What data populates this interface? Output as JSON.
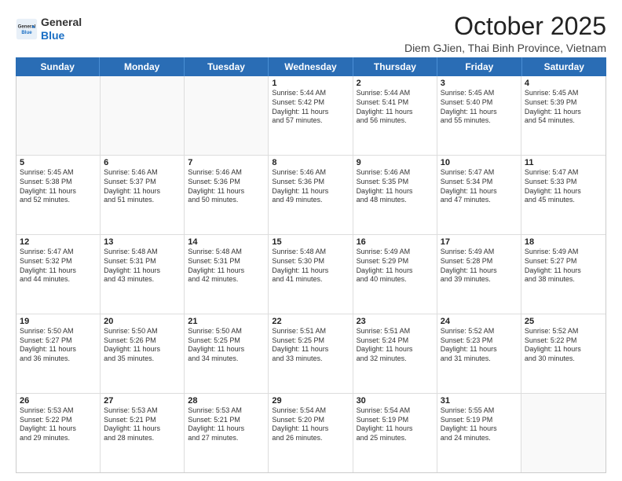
{
  "logo": {
    "general": "General",
    "blue": "Blue"
  },
  "title": "October 2025",
  "subtitle": "Diem GJien, Thai Binh Province, Vietnam",
  "header_days": [
    "Sunday",
    "Monday",
    "Tuesday",
    "Wednesday",
    "Thursday",
    "Friday",
    "Saturday"
  ],
  "rows": [
    [
      {
        "day": "",
        "lines": [],
        "empty": true
      },
      {
        "day": "",
        "lines": [],
        "empty": true
      },
      {
        "day": "",
        "lines": [],
        "empty": true
      },
      {
        "day": "1",
        "lines": [
          "Sunrise: 5:44 AM",
          "Sunset: 5:42 PM",
          "Daylight: 11 hours",
          "and 57 minutes."
        ]
      },
      {
        "day": "2",
        "lines": [
          "Sunrise: 5:44 AM",
          "Sunset: 5:41 PM",
          "Daylight: 11 hours",
          "and 56 minutes."
        ]
      },
      {
        "day": "3",
        "lines": [
          "Sunrise: 5:45 AM",
          "Sunset: 5:40 PM",
          "Daylight: 11 hours",
          "and 55 minutes."
        ]
      },
      {
        "day": "4",
        "lines": [
          "Sunrise: 5:45 AM",
          "Sunset: 5:39 PM",
          "Daylight: 11 hours",
          "and 54 minutes."
        ]
      }
    ],
    [
      {
        "day": "5",
        "lines": [
          "Sunrise: 5:45 AM",
          "Sunset: 5:38 PM",
          "Daylight: 11 hours",
          "and 52 minutes."
        ]
      },
      {
        "day": "6",
        "lines": [
          "Sunrise: 5:46 AM",
          "Sunset: 5:37 PM",
          "Daylight: 11 hours",
          "and 51 minutes."
        ]
      },
      {
        "day": "7",
        "lines": [
          "Sunrise: 5:46 AM",
          "Sunset: 5:36 PM",
          "Daylight: 11 hours",
          "and 50 minutes."
        ]
      },
      {
        "day": "8",
        "lines": [
          "Sunrise: 5:46 AM",
          "Sunset: 5:36 PM",
          "Daylight: 11 hours",
          "and 49 minutes."
        ]
      },
      {
        "day": "9",
        "lines": [
          "Sunrise: 5:46 AM",
          "Sunset: 5:35 PM",
          "Daylight: 11 hours",
          "and 48 minutes."
        ]
      },
      {
        "day": "10",
        "lines": [
          "Sunrise: 5:47 AM",
          "Sunset: 5:34 PM",
          "Daylight: 11 hours",
          "and 47 minutes."
        ]
      },
      {
        "day": "11",
        "lines": [
          "Sunrise: 5:47 AM",
          "Sunset: 5:33 PM",
          "Daylight: 11 hours",
          "and 45 minutes."
        ]
      }
    ],
    [
      {
        "day": "12",
        "lines": [
          "Sunrise: 5:47 AM",
          "Sunset: 5:32 PM",
          "Daylight: 11 hours",
          "and 44 minutes."
        ]
      },
      {
        "day": "13",
        "lines": [
          "Sunrise: 5:48 AM",
          "Sunset: 5:31 PM",
          "Daylight: 11 hours",
          "and 43 minutes."
        ]
      },
      {
        "day": "14",
        "lines": [
          "Sunrise: 5:48 AM",
          "Sunset: 5:31 PM",
          "Daylight: 11 hours",
          "and 42 minutes."
        ]
      },
      {
        "day": "15",
        "lines": [
          "Sunrise: 5:48 AM",
          "Sunset: 5:30 PM",
          "Daylight: 11 hours",
          "and 41 minutes."
        ]
      },
      {
        "day": "16",
        "lines": [
          "Sunrise: 5:49 AM",
          "Sunset: 5:29 PM",
          "Daylight: 11 hours",
          "and 40 minutes."
        ]
      },
      {
        "day": "17",
        "lines": [
          "Sunrise: 5:49 AM",
          "Sunset: 5:28 PM",
          "Daylight: 11 hours",
          "and 39 minutes."
        ]
      },
      {
        "day": "18",
        "lines": [
          "Sunrise: 5:49 AM",
          "Sunset: 5:27 PM",
          "Daylight: 11 hours",
          "and 38 minutes."
        ]
      }
    ],
    [
      {
        "day": "19",
        "lines": [
          "Sunrise: 5:50 AM",
          "Sunset: 5:27 PM",
          "Daylight: 11 hours",
          "and 36 minutes."
        ]
      },
      {
        "day": "20",
        "lines": [
          "Sunrise: 5:50 AM",
          "Sunset: 5:26 PM",
          "Daylight: 11 hours",
          "and 35 minutes."
        ]
      },
      {
        "day": "21",
        "lines": [
          "Sunrise: 5:50 AM",
          "Sunset: 5:25 PM",
          "Daylight: 11 hours",
          "and 34 minutes."
        ]
      },
      {
        "day": "22",
        "lines": [
          "Sunrise: 5:51 AM",
          "Sunset: 5:25 PM",
          "Daylight: 11 hours",
          "and 33 minutes."
        ]
      },
      {
        "day": "23",
        "lines": [
          "Sunrise: 5:51 AM",
          "Sunset: 5:24 PM",
          "Daylight: 11 hours",
          "and 32 minutes."
        ]
      },
      {
        "day": "24",
        "lines": [
          "Sunrise: 5:52 AM",
          "Sunset: 5:23 PM",
          "Daylight: 11 hours",
          "and 31 minutes."
        ]
      },
      {
        "day": "25",
        "lines": [
          "Sunrise: 5:52 AM",
          "Sunset: 5:22 PM",
          "Daylight: 11 hours",
          "and 30 minutes."
        ]
      }
    ],
    [
      {
        "day": "26",
        "lines": [
          "Sunrise: 5:53 AM",
          "Sunset: 5:22 PM",
          "Daylight: 11 hours",
          "and 29 minutes."
        ]
      },
      {
        "day": "27",
        "lines": [
          "Sunrise: 5:53 AM",
          "Sunset: 5:21 PM",
          "Daylight: 11 hours",
          "and 28 minutes."
        ]
      },
      {
        "day": "28",
        "lines": [
          "Sunrise: 5:53 AM",
          "Sunset: 5:21 PM",
          "Daylight: 11 hours",
          "and 27 minutes."
        ]
      },
      {
        "day": "29",
        "lines": [
          "Sunrise: 5:54 AM",
          "Sunset: 5:20 PM",
          "Daylight: 11 hours",
          "and 26 minutes."
        ]
      },
      {
        "day": "30",
        "lines": [
          "Sunrise: 5:54 AM",
          "Sunset: 5:19 PM",
          "Daylight: 11 hours",
          "and 25 minutes."
        ]
      },
      {
        "day": "31",
        "lines": [
          "Sunrise: 5:55 AM",
          "Sunset: 5:19 PM",
          "Daylight: 11 hours",
          "and 24 minutes."
        ]
      },
      {
        "day": "",
        "lines": [],
        "empty": true
      }
    ]
  ]
}
